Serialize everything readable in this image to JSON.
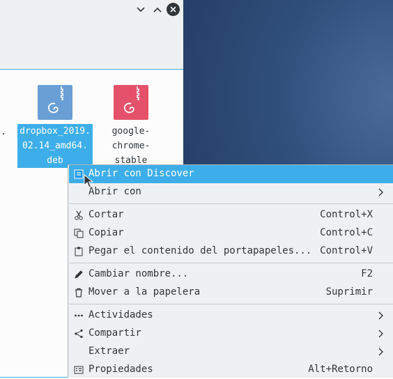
{
  "window": {},
  "files": [
    {
      "name_lines": [
        "dropbox_2019.",
        "02.14_amd64.",
        "deb"
      ],
      "color": "#6a9fd6"
    },
    {
      "name_lines": [
        "google-",
        "chrome-",
        "stable"
      ],
      "color": "#e5516a"
    }
  ],
  "context_menu": {
    "items": [
      {
        "label": "Abrir con Discover",
        "shortcut": "",
        "icon": "discover-icon"
      },
      {
        "label": "Abrir con",
        "shortcut": "",
        "icon": ""
      },
      {
        "label": "Cortar",
        "shortcut": "Control+X",
        "icon": "scissors-icon"
      },
      {
        "label": "Copiar",
        "shortcut": "Control+C",
        "icon": "copy-icon"
      },
      {
        "label": "Pegar el contenido del portapapeles...",
        "shortcut": "Control+V",
        "icon": "paste-icon"
      },
      {
        "label": "Cambiar nombre...",
        "shortcut": "F2",
        "icon": "pencil-icon"
      },
      {
        "label": "Mover a la papelera",
        "shortcut": "Suprimir",
        "icon": "trash-icon"
      },
      {
        "label": "Actividades",
        "shortcut": "",
        "icon": "activities-icon"
      },
      {
        "label": "Compartir",
        "shortcut": "",
        "icon": "share-icon"
      },
      {
        "label": "Extraer",
        "shortcut": "",
        "icon": ""
      },
      {
        "label": "Propiedades",
        "shortcut": "Alt+Retorno",
        "icon": "properties-icon"
      }
    ]
  },
  "colors": {
    "accent": "#3daee9",
    "text": "#31363b",
    "menu_bg": "#eff0f1"
  }
}
